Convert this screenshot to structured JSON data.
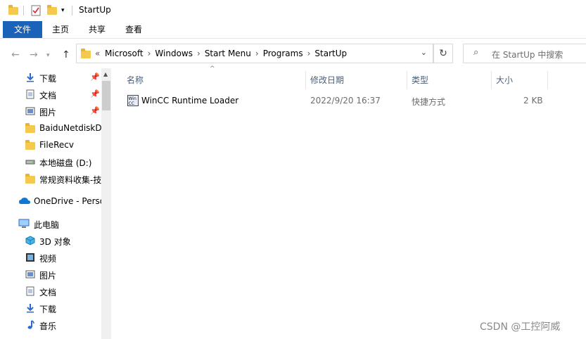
{
  "window": {
    "title": "StartUp"
  },
  "ribbon": {
    "tabs": [
      "文件",
      "主页",
      "共享",
      "查看"
    ]
  },
  "address": {
    "prefix": "«",
    "crumbs": [
      "Microsoft",
      "Windows",
      "Start Menu",
      "Programs",
      "StartUp"
    ],
    "separator": "›"
  },
  "search": {
    "placeholder": "在 StartUp 中搜索"
  },
  "sidebar": {
    "items": [
      {
        "label": "下载",
        "icon": "download-arrow-icon",
        "pinned": true
      },
      {
        "label": "文档",
        "icon": "document-icon",
        "pinned": true
      },
      {
        "label": "图片",
        "icon": "picture-icon",
        "pinned": true
      },
      {
        "label": "BaiduNetdiskD",
        "icon": "folder-icon"
      },
      {
        "label": "FileRecv",
        "icon": "folder-icon"
      },
      {
        "label": "本地磁盘 (D:)",
        "icon": "drive-icon"
      },
      {
        "label": "常规资料收集-技",
        "icon": "folder-icon"
      },
      {
        "label": "OneDrive - Perso",
        "icon": "cloud-icon"
      },
      {
        "label": "此电脑",
        "icon": "computer-icon"
      },
      {
        "label": "3D 对象",
        "icon": "cube-icon"
      },
      {
        "label": "视频",
        "icon": "video-icon"
      },
      {
        "label": "图片",
        "icon": "picture-icon"
      },
      {
        "label": "文档",
        "icon": "document-icon"
      },
      {
        "label": "下载",
        "icon": "download-arrow-icon"
      },
      {
        "label": "音乐",
        "icon": "music-note-icon"
      }
    ]
  },
  "columns": [
    "名称",
    "修改日期",
    "类型",
    "大小"
  ],
  "files": [
    {
      "name": "WinCC Runtime Loader",
      "date": "2022/9/20 16:37",
      "type": "快捷方式",
      "size": "2 KB"
    }
  ],
  "watermark": "CSDN @工控阿威",
  "colors": {
    "accent": "#1a63b8",
    "folder": "#f4c94e",
    "header_text": "#4c607a"
  }
}
